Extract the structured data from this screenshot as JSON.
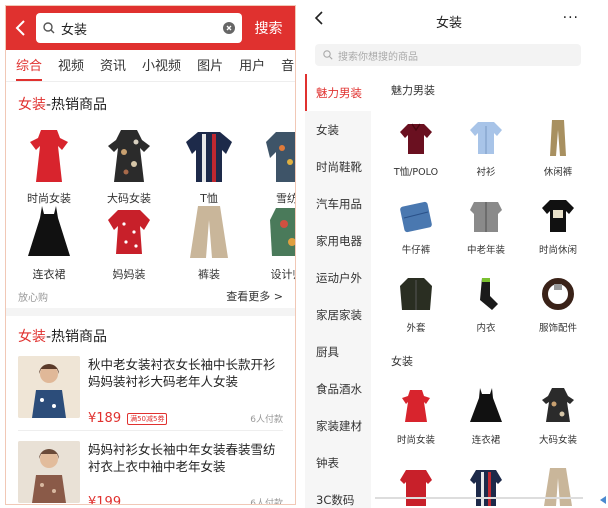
{
  "search": {
    "query": "女装",
    "button": "搜索"
  },
  "tabs": [
    "综合",
    "视频",
    "资讯",
    "小视频",
    "图片",
    "用户",
    "音"
  ],
  "hot1": {
    "title_hl": "女装",
    "title_rest": "-热销商品",
    "items": [
      "时尚女装",
      "大码女装",
      "T恤",
      "雪纺",
      "连衣裙",
      "妈妈装",
      "裤装",
      "设计师"
    ],
    "footer_left": "放心购",
    "more": "查看更多 >"
  },
  "hot2": {
    "title_hl": "女装",
    "title_rest": "-热销商品",
    "products": [
      {
        "title": "秋中老女装衬衣女长袖中长款开衫妈妈装衬衫大码老年人女装",
        "price": "¥189",
        "promo": "满50减5券",
        "paid": "6人付款"
      },
      {
        "title": "妈妈衬衫女长袖中年女装春装雪纺衬衣上衣中袖中老年女装",
        "price": "¥199",
        "promo": "",
        "paid": "6人付款"
      }
    ]
  },
  "right": {
    "title": "女装",
    "more": "···",
    "search_placeholder": "搜索你想搜的商品",
    "categories": [
      "魅力男装",
      "女装",
      "时尚鞋靴",
      "汽车用品",
      "家用电器",
      "运动户外",
      "家居家装",
      "厨具",
      "食品酒水",
      "家装建材",
      "钟表",
      "3C数码"
    ],
    "sec1": {
      "title": "魅力男装",
      "items": [
        "T恤/POLO",
        "衬衫",
        "休闲裤",
        "牛仔裤",
        "中老年装",
        "时尚休闲",
        "外套",
        "内衣",
        "服饰配件"
      ]
    },
    "sec2": {
      "title": "女装",
      "items": [
        "时尚女装",
        "连衣裙",
        "大码女装"
      ]
    }
  },
  "colors": {
    "accent": "#e0312f"
  }
}
